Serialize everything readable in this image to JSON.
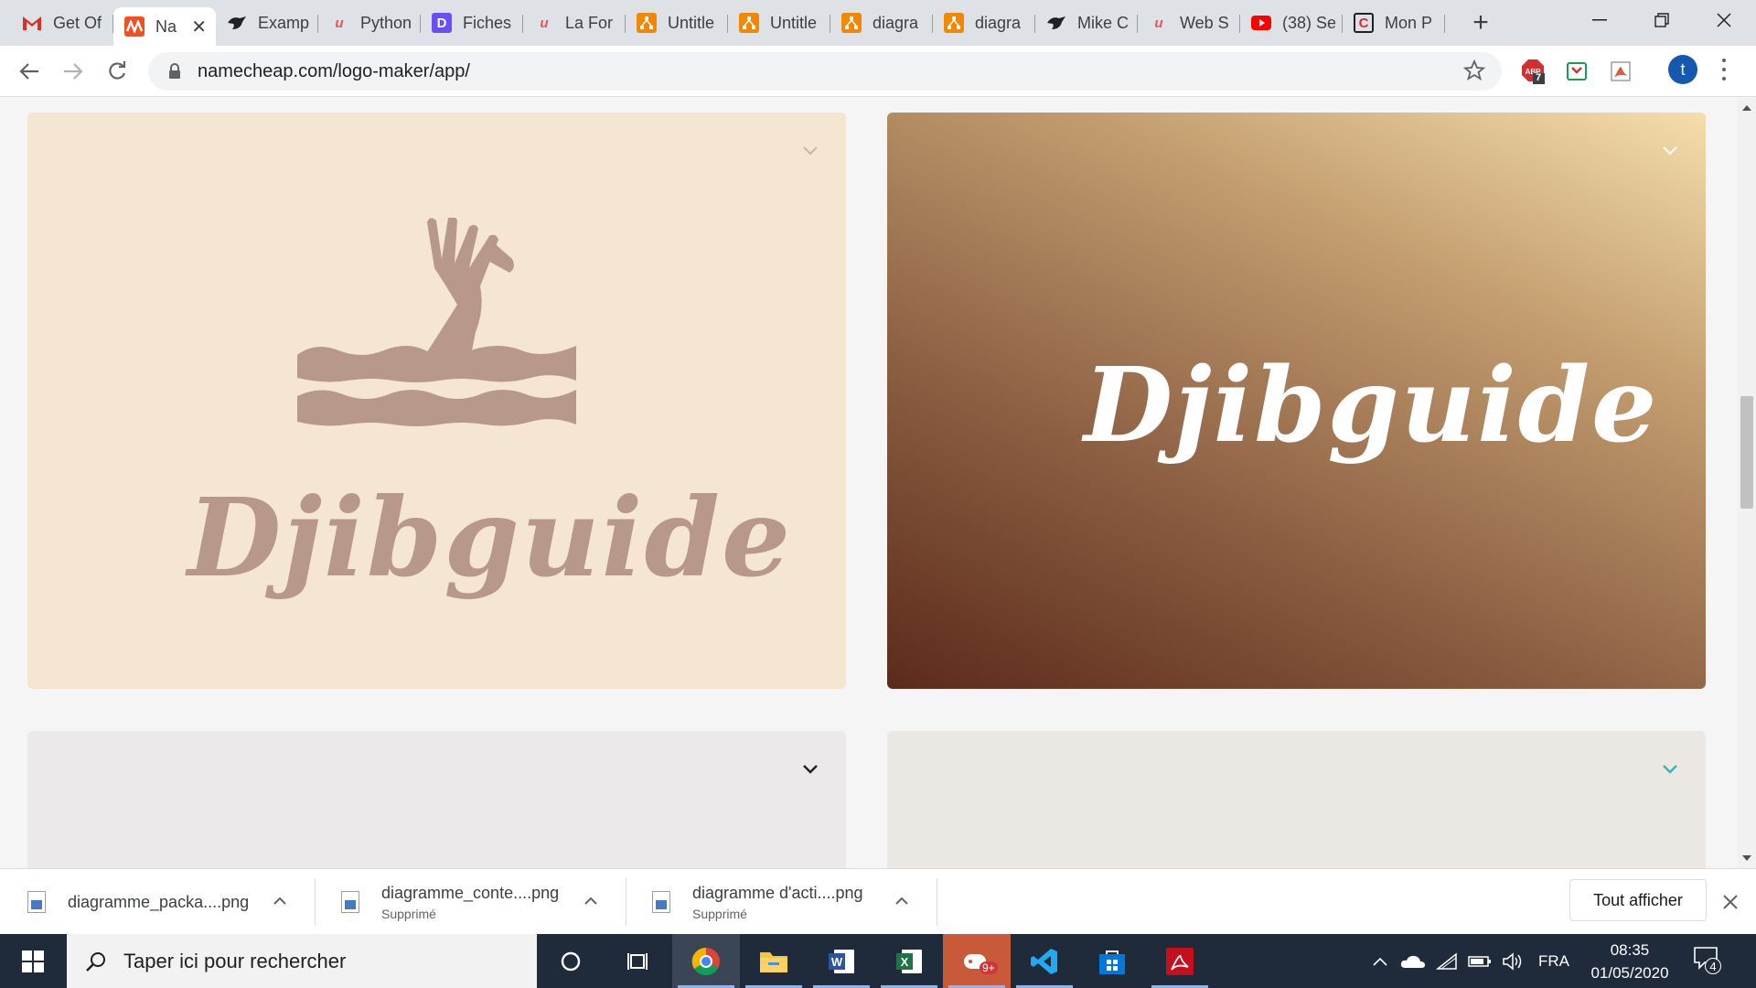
{
  "browser": {
    "tabs": [
      {
        "label": "Get Of",
        "icon": "gmail-icon",
        "color": "#d93025"
      },
      {
        "label": "Na",
        "icon": "namecheap-icon",
        "color": "#f25022",
        "active": true
      },
      {
        "label": "Examp",
        "icon": "bird-icon",
        "color": "#202124"
      },
      {
        "label": "Python",
        "icon": "udemy-icon",
        "color": "#ec5252"
      },
      {
        "label": "Fiches",
        "icon": "d-app-icon",
        "color": "#6c4ef5"
      },
      {
        "label": "La For",
        "icon": "udemy-icon",
        "color": "#ec5252"
      },
      {
        "label": "Untitle",
        "icon": "drawio-icon",
        "color": "#f08705"
      },
      {
        "label": "Untitle",
        "icon": "drawio-icon",
        "color": "#f08705"
      },
      {
        "label": "diagra",
        "icon": "drawio-icon",
        "color": "#f08705"
      },
      {
        "label": "diagra",
        "icon": "drawio-icon",
        "color": "#f08705"
      },
      {
        "label": "Mike C",
        "icon": "bird-icon",
        "color": "#202124"
      },
      {
        "label": "Web S",
        "icon": "udemy-icon",
        "color": "#ec5252"
      },
      {
        "label": "(38) Se",
        "icon": "youtube-icon",
        "color": "#ff0000"
      },
      {
        "label": "Mon P",
        "icon": "c-site-icon",
        "color": "#d32f2f"
      }
    ],
    "url": "namecheap.com/logo-maker/app/",
    "extensions": {
      "adblock_badge": "7"
    },
    "profile_initial": "t"
  },
  "logos": [
    {
      "brand": "Djibguide",
      "background": "#f4e6d1",
      "text_color": "#b8988b"
    },
    {
      "brand": "Djibguide",
      "background": "gradient-brown",
      "text_color": "#ffffff"
    },
    {
      "brand": "",
      "background": "#ebe9ea"
    },
    {
      "brand": "",
      "background": "#ebe7e2"
    }
  ],
  "downloads": [
    {
      "name": "diagramme_packa....png",
      "status": ""
    },
    {
      "name": "diagramme_conte....png",
      "status": "Supprimé"
    },
    {
      "name": "diagramme d'acti....png",
      "status": "Supprimé"
    }
  ],
  "shelf": {
    "show_all": "Tout afficher"
  },
  "taskbar": {
    "search_placeholder": "Taper ici pour rechercher",
    "apps": [
      "cortana-icon",
      "task-view-icon",
      "chrome-icon",
      "file-explorer-icon",
      "word-icon",
      "excel-icon",
      "game-app-icon",
      "vscode-icon",
      "store-icon",
      "acrobat-icon"
    ],
    "game_badge": "9+",
    "language": "FRA",
    "time": "08:35",
    "date": "01/05/2020",
    "notifications": "4"
  }
}
